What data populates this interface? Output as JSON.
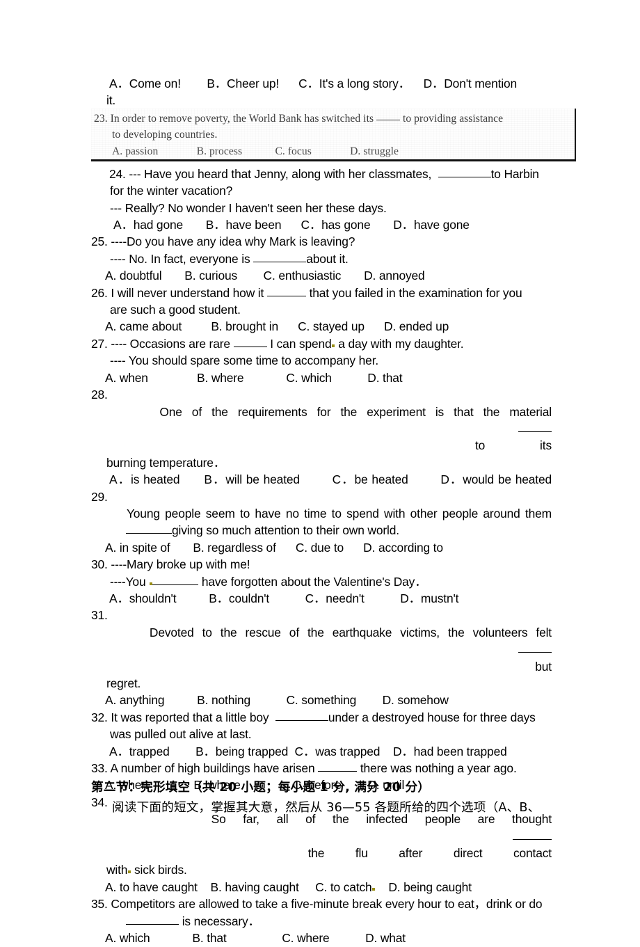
{
  "document": {
    "type": "english-exam-paper-page",
    "language_mix": [
      "en",
      "zh"
    ]
  },
  "q22_options": {
    "line1": "A．Come on!        B．Cheer up!      C．It's a long story．    D．Don't mention",
    "line2": "it."
  },
  "q23_scanned": {
    "number": "23.",
    "stem_line1": "In order to remove poverty, the World Bank has switched its",
    "stem_line1_tail": "to providing assistance",
    "stem_line2": "to developing countries.",
    "options_line": "A. passion              B. process            C. focus              D. struggle",
    "options": [
      "A. passion",
      "B. process",
      "C. focus",
      "D. struggle"
    ],
    "style_note": "low-quality scanned insert, serif face, bordered"
  },
  "questions": [
    {
      "number": "24.",
      "stem_a": "--- Have you heard that Jenny, along with her classmates,",
      "stem_a_tail": "to Harbin",
      "stem_b": "for the winter vacation?",
      "stem_c": "--- Really? No wonder I haven't seen her these days.",
      "options_line": "A．had gone       B．have been      C．has gone       D．have gone",
      "options": [
        "A．had gone",
        "B．have been",
        "C．has gone",
        "D．have gone"
      ]
    },
    {
      "number": "25.",
      "stem_a": "----Do you have any idea why Mark is leaving?",
      "stem_b": "---- No. In fact, everyone is",
      "stem_b_tail": "about it.",
      "options_line": "A. doubtful       B. curious        C. enthusiastic       D. annoyed",
      "options": [
        "A. doubtful",
        "B. curious",
        "C. enthusiastic",
        "D. annoyed"
      ]
    },
    {
      "number": "26.",
      "stem_a": "I will never understand how it",
      "stem_a_tail": "that you failed in the examination for you",
      "stem_b": "are such a good student.",
      "options_line": "A. came about         B. brought in      C. stayed up      D. ended up",
      "options": [
        "A. came about",
        "B. brought in",
        "C. stayed up",
        "D. ended up"
      ]
    },
    {
      "number": "27.",
      "stem_a": "---- Occasions are rare",
      "stem_a_tail": "I can spend",
      "stem_a_tail2": "a day with my daughter.",
      "stem_b": "---- You should spare some time to accompany her.",
      "options_line": "A. when               B. where             C. which           D. that",
      "options": [
        "A. when",
        "B. where",
        "C. which",
        "D. that"
      ]
    },
    {
      "number": "28.",
      "stem_a": "One of the requirements for the experiment is that the material",
      "stem_a_tail": "to its",
      "stem_b": "burning temperature．",
      "options_line": "A．is heated      B．will be heated        C．be heated        D．would be heated",
      "options": [
        "A．is heated",
        "B．will be heated",
        "C．be heated",
        "D．would be heated"
      ]
    },
    {
      "number": "29.",
      "stem_a": "Young people seem to have no time to spend with other people around them",
      "stem_b_tail": "giving so much attention to their own world.",
      "options_line": "A. in spite of       B. regardless of      C. due to      D. according to",
      "options": [
        "A. in spite of",
        "B. regardless of",
        "C. due to",
        "D. according to"
      ]
    },
    {
      "number": "30.",
      "stem_a": "----Mary broke up with me!",
      "stem_b": "----You",
      "stem_b_tail": "have forgotten about the Valentine's Day．",
      "options_line": "A．shouldn't          B．couldn't           C．needn't           D．mustn't",
      "options": [
        "A．shouldn't",
        "B．couldn't",
        "C．needn't",
        "D．mustn't"
      ]
    },
    {
      "number": "31.",
      "stem_a": "Devoted to the rescue of the earthquake victims, the volunteers felt",
      "stem_a_tail": "but",
      "stem_b": "regret.",
      "options_line": "A. anything          B. nothing           C. something        D. somehow",
      "options": [
        "A. anything",
        "B. nothing",
        "C. something",
        "D. somehow"
      ]
    },
    {
      "number": "32.",
      "stem_a": "It was reported that a little boy",
      "stem_a_tail": "under a destroyed house for three days",
      "stem_b": "was pulled out alive at last.",
      "options_line": "A．trapped        B．being trapped  C．was trapped    D．had been trapped",
      "options": [
        "A．trapped",
        "B．being trapped",
        "C．was trapped",
        "D．had been trapped"
      ]
    },
    {
      "number": "33.",
      "stem_a": "A number of high buildings have arisen",
      "stem_a_tail": "there was nothing a year ago.",
      "options_line": "A. when              B. where                C. before        D. until",
      "options": [
        "A. when",
        "B. where",
        "C. before",
        "D. until"
      ]
    },
    {
      "number": "34.",
      "stem_a": "So far, all of the infected people are thought",
      "stem_a_tail": "the flu after direct contact",
      "stem_b": "with",
      "stem_b_tail": "sick birds.",
      "options_line": "A. to have caught    B. having caught     C. to catch",
      "options_line_tail": "D. being caught",
      "options": [
        "A. to have caught",
        "B. having caught",
        "C. to catch",
        "D. being caught"
      ]
    },
    {
      "number": "35.",
      "stem_a": "Competitors are allowed to take a five-minute break every hour to eat，drink or do",
      "stem_b_tail": "is necessary．",
      "options_line": "A. which             B. that                 C. where           D. what",
      "options": [
        "A. which",
        "B. that",
        "C. where",
        "D. what"
      ]
    }
  ],
  "section_two": {
    "heading": "第二节：完形填空（共 20 小题；每小题 1 分, 满分 20 分）",
    "instruction": "阅读下面的短文，掌握其大意，然后从 36—55 各题所给的四个选项（A、B、"
  },
  "colors": {
    "text": "#000000",
    "scan_text": "#3a3a3a",
    "annotation_dot": "#9a8f16",
    "border": "#111111",
    "background": "#ffffff"
  }
}
